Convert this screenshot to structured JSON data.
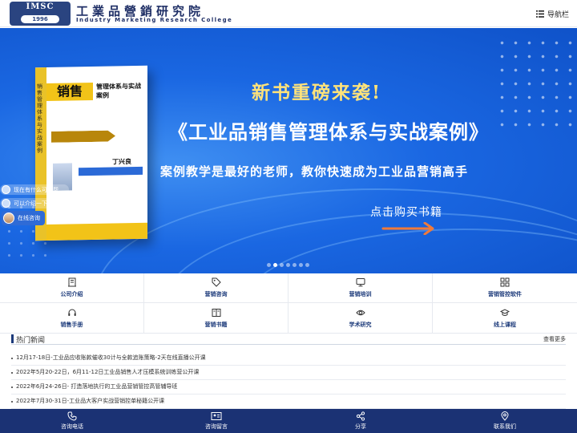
{
  "header": {
    "logo_badge": "IMSC",
    "logo_year": "1996",
    "logo_cn": "工業品營銷研究院",
    "logo_en": "Industry Marketing Research College",
    "nav_label": "导航栏"
  },
  "banner": {
    "title1": "新书重磅来袭!",
    "title2": "《工业品销售管理体系与实战案例》",
    "title3": "案例教学是最好的老师，教你快速成为工业品营销高手",
    "cta": "点击购买书籍",
    "book": {
      "spine": "销售管理体系与实战案例",
      "cover_main": "销售",
      "cover_sub": "管理体系与实战案例",
      "author": "丁兴良"
    },
    "slides": 7,
    "active_slide": 2
  },
  "chat": {
    "msg1": "现在有什么可以帮...",
    "msg2": "可以介绍一下你们的产品吗？",
    "agent": "在线咨询"
  },
  "menu": [
    {
      "label": "公司介绍",
      "icon": "building-icon"
    },
    {
      "label": "营销咨询",
      "icon": "tag-icon"
    },
    {
      "label": "营销培训",
      "icon": "monitor-icon"
    },
    {
      "label": "营销管控软件",
      "icon": "grid-icon"
    },
    {
      "label": "销售手册",
      "icon": "headset-icon"
    },
    {
      "label": "营销书籍",
      "icon": "book-icon"
    },
    {
      "label": "学术研究",
      "icon": "eye-icon"
    },
    {
      "label": "线上课程",
      "icon": "graduation-cap-icon"
    }
  ],
  "news": {
    "title": "热门新闻",
    "more": "查看更多",
    "items": [
      "12月17-18日-工业品应收账款催收30计与全款追账策略-2天在线直播公开课",
      "2022年5月20-22日，6月11-12日工业品销售人才压模系统训练营公开课",
      "2022年6月24-26日- 打造落地执行的工业品营销管控高管辅导班",
      "2022年7月30-31日-工业品大客户实战营销控单秘籍公开课"
    ]
  },
  "footer": [
    {
      "label": "咨询电话",
      "icon": "phone-icon"
    },
    {
      "label": "咨询留言",
      "icon": "message-card-icon"
    },
    {
      "label": "分享",
      "icon": "share-icon"
    },
    {
      "label": "联系我们",
      "icon": "location-pin-icon"
    }
  ],
  "colors": {
    "brand_navy": "#1b3274",
    "banner_blue": "#1a67e2",
    "headline_gold": "#ffe37a",
    "book_yellow": "#f2c318"
  }
}
